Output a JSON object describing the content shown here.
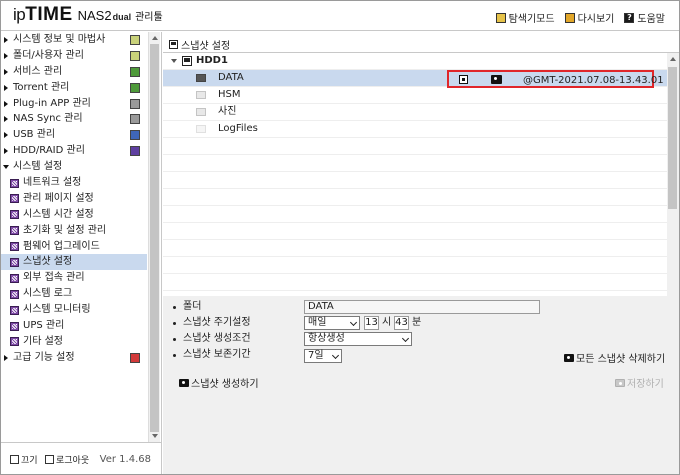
{
  "header": {
    "logo": {
      "ip": "ip",
      "time": "TIME",
      "model": "NAS2",
      "dual": "dual",
      "manager": "관리툴"
    },
    "links": [
      {
        "label": "탐색기모드",
        "icon": "explorer-mode-icon"
      },
      {
        "label": "다시보기",
        "icon": "refresh-icon"
      },
      {
        "label": "도움말",
        "icon": "help-icon",
        "glyph": "?"
      }
    ]
  },
  "sidebar": {
    "menus": [
      {
        "label": "시스템 정보 및 마법사",
        "icon": "chart-icon",
        "color": "#c9d27a"
      },
      {
        "label": "폴더/사용자 관리",
        "icon": "users-icon",
        "color": "#c9d27a"
      },
      {
        "label": "서비스 관리",
        "icon": "service-icon",
        "color": "#4e9a3a"
      },
      {
        "label": "Torrent 관리",
        "icon": "torrent-icon",
        "color": "#4e9a3a"
      },
      {
        "label": "Plug-in APP 관리",
        "icon": "plugin-icon",
        "color": "#9a9a9a"
      },
      {
        "label": "NAS Sync 관리",
        "icon": "sync-icon",
        "color": "#9a9a9a"
      },
      {
        "label": "USB 관리",
        "icon": "usb-icon",
        "color": "#3f66b8"
      },
      {
        "label": "HDD/RAID 관리",
        "icon": "hdd-raid-icon",
        "color": "#5e3fa0"
      }
    ],
    "system_settings": {
      "label": "시스템 설정",
      "items": [
        "네트워크 설정",
        "관리 페이지 설정",
        "시스템 시간 설정",
        "초기화 및 설정 관리",
        "펌웨어 업그레이드",
        "스냅샷 설정",
        "외부 접속 관리",
        "시스템 로그",
        "시스템 모니터링",
        "UPS 관리",
        "기타 설정"
      ],
      "selected_index": 5
    },
    "advanced": {
      "label": "고급 기능 설정",
      "color": "#d23a3a"
    }
  },
  "footer": {
    "power_label": "끄기",
    "logout_label": "로그아웃",
    "version": "Ver 1.4.68"
  },
  "main": {
    "page_title": "스냅샷 설정",
    "tree": {
      "hdd": "HDD1",
      "folders": [
        {
          "name": "DATA",
          "selected": true
        },
        {
          "name": "HSM",
          "selected": false
        },
        {
          "name": "사진",
          "selected": false
        },
        {
          "name": "LogFiles",
          "selected": false
        }
      ],
      "snapshot_label": "@GMT-2021.07.08-13.43.01"
    },
    "settings": {
      "folder_label": "폴더",
      "folder_value": "DATA",
      "cycle_label": "스냅샷 주기설정",
      "cycle_value": "매일",
      "hour": "13",
      "hour_unit": "시",
      "minute": "43",
      "minute_unit": "분",
      "condition_label": "스냅샷 생성조건",
      "condition_value": "항상생성",
      "retention_label": "스냅샷 보존기간",
      "retention_value": "7일",
      "delete_all_label": "모든 스냅샷 삭제하기",
      "create_label": "스냅샷 생성하기",
      "save_label": "저장하기"
    }
  }
}
